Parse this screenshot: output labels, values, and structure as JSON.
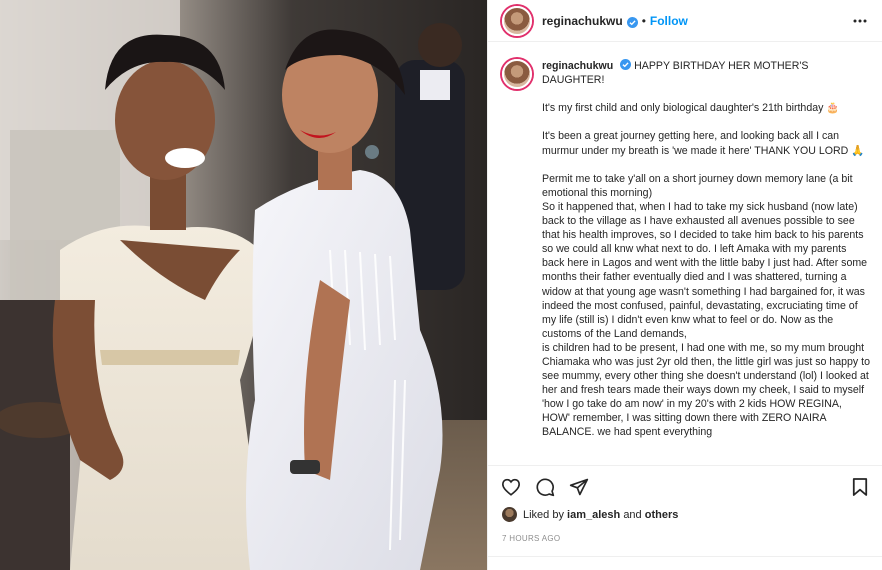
{
  "post": {
    "username": "reginachukwu",
    "follow_label": "Follow",
    "separator": "•",
    "caption": {
      "username": "reginachukwu",
      "headline": "HAPPY BIRTHDAY HER MOTHER'S DAUGHTER!",
      "paragraph_1": "It's my first child and only biological daughter's 21th birthday 🎂",
      "paragraph_2": "It's been a great journey getting here, and looking back all I can murmur under my breath is 'we made it here' THANK YOU LORD 🙏",
      "paragraph_3": "Permit me to take y'all on a short journey down memory lane (a bit emotional this morning)",
      "paragraph_4": "So it happened that, when I had to take my sick husband (now late) back to the village as I have exhausted all avenues possible to see that his health improves, so I decided to take him back to his parents so we could all knw what next to do. I left Amaka with my parents back here in Lagos and went with the little baby I just had. After some months their father eventually died and I was shattered, turning a widow at that young age wasn't something I had bargained for, it was indeed the most confused, painful, devastating, excruciating time of my life (still is) I didn't even knw what to feel or do. Now as the customs of the Land demands,",
      "paragraph_5": "is children had to be present, I had one with me, so my mum brought Chiamaka who was just 2yr old then, the little girl was just so happy to see mummy, every other thing she doesn't understand (lol) I looked at her and fresh tears made their ways down my cheek, I said to myself 'how I go take do am now' in my 20's with 2 kids HOW REGINA, HOW' remember, I was sitting down there with ZERO NAIRA BALANCE. we had spent everything"
    },
    "likes": {
      "prefix": "Liked by",
      "user": "iam_alesh",
      "and": "and",
      "others": "others"
    },
    "timestamp": "7 HOURS AGO"
  },
  "icons": {
    "verified": "verified-badge-icon",
    "more": "more-options-icon",
    "like": "heart-icon",
    "comment": "comment-icon",
    "share": "paper-plane-icon",
    "save": "bookmark-icon"
  },
  "colors": {
    "follow": "#0095f6",
    "verified": "#3897f0",
    "text": "#262626",
    "muted": "#8e8e8e",
    "divider": "#efefef"
  }
}
